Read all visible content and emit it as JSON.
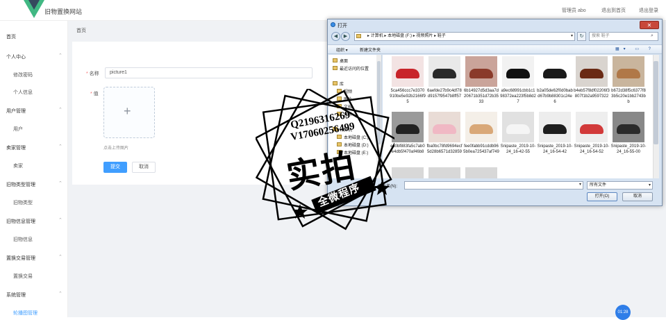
{
  "header": {
    "site_title": "旧物置换网站",
    "admin_label": "管理员 abo",
    "back_home": "退出到首页",
    "logout": "退出登录"
  },
  "sidebar": {
    "home": "首页",
    "groups": [
      {
        "label": "个人中心",
        "items": [
          "修改密码",
          "个人信息"
        ]
      },
      {
        "label": "用户管理",
        "items": [
          "用户"
        ]
      },
      {
        "label": "卖家管理",
        "items": [
          "卖家"
        ]
      },
      {
        "label": "旧物类型管理",
        "items": [
          "旧物类型"
        ]
      },
      {
        "label": "旧物信息管理",
        "items": [
          "旧物信息"
        ]
      },
      {
        "label": "置换交易管理",
        "items": [
          "置换交易"
        ]
      },
      {
        "label": "系统管理",
        "items": [
          "轮播图管理"
        ]
      }
    ]
  },
  "main": {
    "breadcrumb": "首页",
    "form": {
      "name_label": "名称",
      "name_value": "picture1",
      "value_label": "值",
      "upload_tip": "点击上传图片",
      "submit": "提交",
      "cancel": "取消"
    }
  },
  "dialog": {
    "title": "打开",
    "close": "✕",
    "path": [
      "计算机",
      "本地磁盘 (F:)",
      "视频照片",
      "鞋子"
    ],
    "search_placeholder": "搜索 鞋子",
    "toolbar": {
      "organize": "组织 ▾",
      "new_folder": "新建文件夹"
    },
    "nav_items": [
      "桌面",
      "最近访问的位置",
      "库",
      "视频",
      "图片",
      "文档",
      "音乐",
      "计算机",
      "本地磁盘 (C:)",
      "本地磁盘 (D:)",
      "本地磁盘 (E:)"
    ],
    "files": [
      {
        "name": "5ca456ccc7e3370910be5e92b2166f95",
        "color": "#c8242a",
        "bg": "#f3e3e3"
      },
      {
        "name": "6aefde27b9c4df78d9157f9547b8ff57",
        "color": "#2a2a2a",
        "bg": "#e9e9e9"
      },
      {
        "name": "6b14927d5d3aa7d20671b351d72b3533",
        "color": "#8a3a2a",
        "bg": "#caa49a"
      },
      {
        "name": "a9ec68991cbb1c198372ea223f5b8d27",
        "color": "#111111",
        "bg": "#f2f2f2"
      },
      {
        "name": "b2a05de62f0d0babd67b9b88301c24e6",
        "color": "#1a1a1a",
        "bg": "#ffffff"
      },
      {
        "name": "b4eb57f8df02206f3807f1b2a9597322",
        "color": "#6a2a14",
        "bg": "#d9d4cf"
      },
      {
        "name": "b672d38f5c6377f83b5c20e1bb2743bb",
        "color": "#b07848",
        "bg": "#c9b59d"
      },
      {
        "name": "ec0bf883fa5c7ab0e4db5f470af46b8",
        "color": "#222222",
        "bg": "#9a9a9a"
      },
      {
        "name": "fba0bc78fd9694ecf5d28b6571d32859",
        "color": "#f0b8c4",
        "bg": "#e9dcd6"
      },
      {
        "name": "fee0fabb91cddb965b0ea725437af749",
        "color": "#d9a878",
        "bg": "#f4efe8"
      },
      {
        "name": "Snipaste_2019-10-24_16-42-55",
        "color": "#f5f5f5",
        "bg": "#e1e1e1"
      },
      {
        "name": "Snipaste_2019-10-24_16-54-42",
        "color": "#1e1e1e",
        "bg": "#ededed"
      },
      {
        "name": "Snipaste_2019-10-24_16-54-52",
        "color": "#d23a3a",
        "bg": "#eeeeee"
      },
      {
        "name": "Snipaste_2019-10-24_16-55-00",
        "color": "#2a2a2a",
        "bg": "#888888"
      }
    ],
    "filename_label": "文件名(N):",
    "filetype": "所有文件",
    "open": "打开(O)",
    "cancel": "取消"
  },
  "watermark": {
    "line1": "Q2196316269",
    "line2": "V17060256499",
    "main": "实拍",
    "sub": "全微程序"
  },
  "timer": "01:28",
  "colors": {
    "primary": "#409eff",
    "timer": "#2f7ee8",
    "logo_green": "#41b883",
    "logo_dark": "#35495e"
  }
}
